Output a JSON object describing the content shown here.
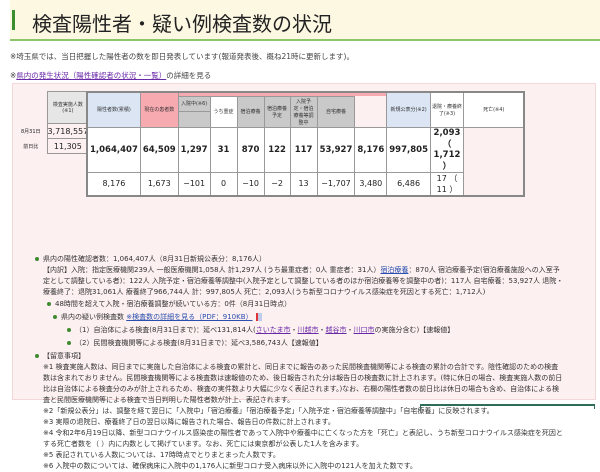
{
  "title": "検査陽性者・疑い例検査数の状況",
  "note1": "※埼玉県では、当日把握した陽性者の数を即日発表しています(報道発表後、概ね21時に更新します)。",
  "note2_prefix": "※",
  "note2_link": "県内の発生状況（陽性確認者の状況・一覧）",
  "note2_suffix": "の詳細を見る",
  "table": {
    "headers": {
      "tests": "検査実施人数(※1)",
      "positive": "陽性者数(累積)",
      "current": "現在の患者数",
      "hospital": "入院中(※6)",
      "severe": "うち重症",
      "hotel": "宿泊療養",
      "hotel_plan": "宿泊療養予定",
      "adjusting": "入院予定・宿泊療養等調整中",
      "home": "自宅療養",
      "new": "新規公表分(※2)",
      "discharged": "退院・療養終了(※3)",
      "death": "死亡(※4)"
    },
    "rows": [
      {
        "label": "8月31日",
        "tests": "3,718,557",
        "positive": "1,064,407",
        "current": "64,509",
        "hospital": "1,297",
        "severe": "31",
        "hotel": "870",
        "hotel_plan": "122",
        "adjusting": "117",
        "home": "53,927",
        "new": "8,176",
        "discharged": "997,805",
        "death": "2,093（ 1,712 ）"
      },
      {
        "label": "前日比",
        "tests": "11,305",
        "positive": "8,176",
        "current": "1,673",
        "hospital": "−101",
        "severe": "0",
        "hotel": "−10",
        "hotel_plan": "−2",
        "adjusting": "13",
        "home": "−1,707",
        "new": "3,480",
        "discharged": "6,486",
        "death": "17 （ 11 ）"
      }
    ]
  },
  "summary": {
    "line1": "県内の陽性確認者数：1,064,407人（8月31日新規公表分：8,176人）",
    "line2a": "【内訳】入院：指定医療機関239人 一般医療機関1,058人 計1,297人 (うち最重症者：0人 重症者：31人）",
    "line2_link": "宿泊療養",
    "line2b": "：870人 宿泊療養予定(宿泊療養施設への入室予",
    "line3": "定として調整している者)：122人 入院予定・宿泊療養等調整中(入院予定として調整している者のほか宿泊療養等を調整中の者)：117人 自宅療養：53,927人 退院・",
    "line4": "療養終了：退院31,061人 療養終了966,744人 計：997,805人 死亡：2,093人(うち新型コロナウイルス感染症を死因とする死亡：1,712人)",
    "line5": "48時間を超えて入院・宿泊療養調整が続いている方：0件（8月31日時点）",
    "line6": "県内の疑い例検査数",
    "line6_link": "※検査数の詳細を見る（PDF：910KB）",
    "line7a": "（1）自治体による検査(8月31日まで)：延べ131,814人(",
    "cities": [
      "さいたま市",
      "川越市",
      "越谷市",
      "川口市"
    ],
    "line7b": "の実施分含む)【速報値】",
    "line8": "（2）民間検査機関等による検査(8月31日まで)：延べ3,586,743人【速報値】"
  },
  "remarks": {
    "heading": "【留意事項】",
    "lines": [
      "※1 検査実施人数は、同日までに実施した自治体による検査の累計と、同日までに報告のあった民間検査機関等による検査の累計の合計です。陰性確認のための検査",
      "数は含まれておりません。民間検査機関等による検査数は速報値のため、後日報告された分は報告日の検査数に計上されます。(特に休日の場合、検査実施人数の前日",
      "比は自治体による検査分のみが計上されるため、検査の実件数より大幅に少なく表記されます。)なお、右欄の陽性者数の前日比は休日の場合も含め、自治体による検",
      "査と民間医療機関等による検査で当日判明した陽性者数が計上、表記されます。",
      "※2「新規公表分」は、調整を経て翌日に「入院中」「宿泊療養」「宿泊療養予定」「入院予定・宿泊療養等調整中」「自宅療養」に反映されます。",
      "※3 実際の退院日、療養終了日の翌日以降に報告された場合、報告日の件数に計上されます。",
      "※4 令和2年6月19日以降、新型コロナウイルス感染症の陽性者であって入院中や療養中に亡くなった方を「死亡」と表記し、うち新型コロナウイルス感染症を死因と",
      "する死亡者数を（ ）内に内数として掲げています。なお、死亡には東京都が公表した1人を含みます。",
      "※5 表記されている人数については、17時時点でとりまとまった人数です。",
      "※6 入院中の数については、確保病床に入院中の1,176人に新型コロナ受入病床以外に入院中の121人を加えた数です。"
    ]
  }
}
